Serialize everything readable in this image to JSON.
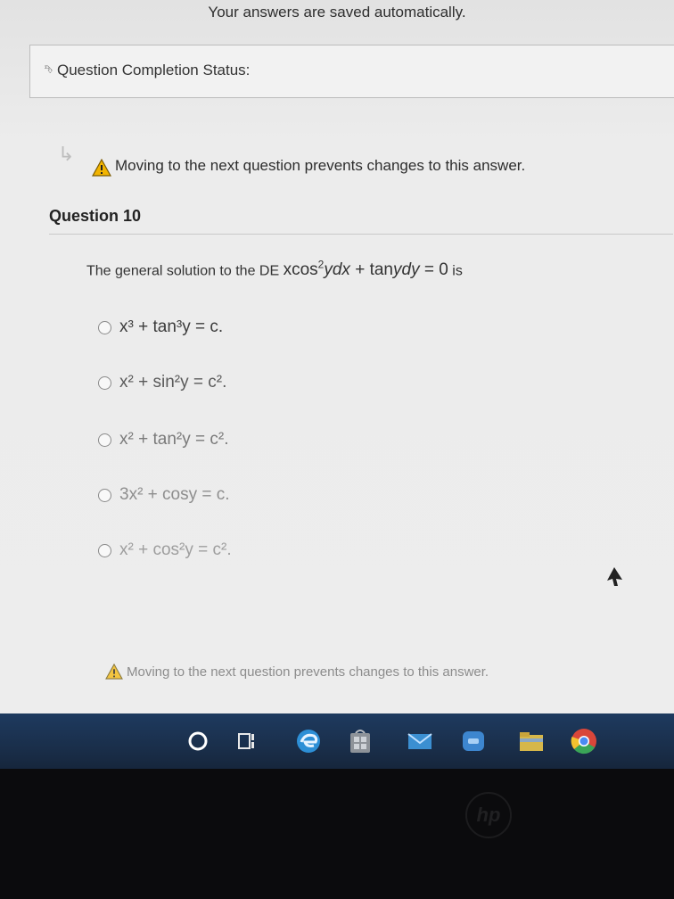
{
  "header": {
    "saved_message": "Your answers are saved automatically."
  },
  "completion": {
    "label": "Question Completion Status:"
  },
  "warning": {
    "text": "Moving to the next question prevents changes to this answer."
  },
  "question": {
    "title": "Question 10",
    "prompt_prefix": "The general solution to the DE",
    "prompt_suffix": "is",
    "options": [
      "x³ + tan³y = c.",
      "x² + sin²y = c².",
      "x² + tan²y = c².",
      "3x² + cosy = c.",
      "x² + cos²y = c²."
    ]
  },
  "icons": {
    "warning": "warning-triangle-icon",
    "taskbar": [
      "cortana-icon",
      "task-view-icon",
      "edge-icon",
      "store-icon",
      "mail-icon",
      "app-icon",
      "file-explorer-icon",
      "chrome-icon"
    ],
    "brand": "hp-logo"
  },
  "colors": {
    "taskbar": "#1e3a5f",
    "warning": "#f2b400",
    "bezel": "#0b0b0d"
  }
}
